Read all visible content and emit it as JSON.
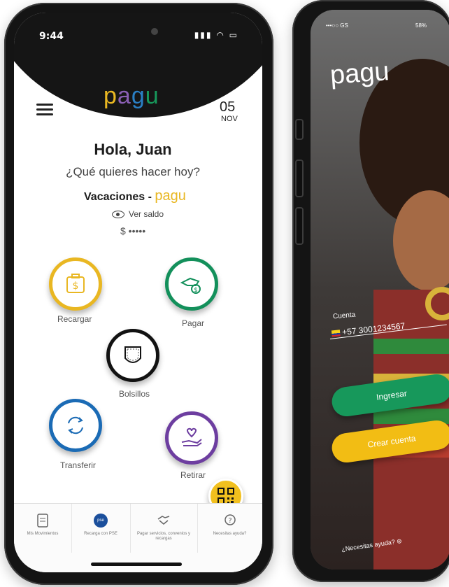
{
  "colors": {
    "recargar": "#e9b722",
    "pagar": "#13905b",
    "bolsillos": "#121212",
    "transferir": "#1b6bb5",
    "retirar": "#6d3ea0",
    "ingresar": "#17985b",
    "crear_cuenta": "#f2bd14"
  },
  "left_phone": {
    "status": {
      "time": "9:44"
    },
    "logo": {
      "l1": "p",
      "l2": "a",
      "l3": "g",
      "l4": "u"
    },
    "date": {
      "day": "05",
      "month": "NOV"
    },
    "greeting": "Hola, Juan",
    "question": "¿Qué quieres hacer hoy?",
    "wallet_name": "Vacaciones -",
    "wallet_brand": "pagu",
    "ver_saldo": "Ver saldo",
    "saldo": "$ •••••",
    "actions": {
      "recargar": {
        "label": "Recargar",
        "icon": "money-bag-icon"
      },
      "pagar": {
        "label": "Pagar",
        "icon": "hand-coin-icon"
      },
      "bolsillos": {
        "label": "Bolsillos",
        "icon": "pocket-icon"
      },
      "transferir": {
        "label": "Transferir",
        "icon": "transfer-arrows-icon"
      },
      "retirar": {
        "label": "Retirar",
        "icon": "hand-heart-icon"
      }
    },
    "bottom_nav": [
      {
        "label": "Mis Movimientos",
        "icon": "document-icon"
      },
      {
        "label": "Recarga con PSE",
        "icon": "pse-icon",
        "badge": "pse"
      },
      {
        "label": "Pagar servicios, convenios y recargas",
        "icon": "handshake-icon"
      },
      {
        "label": "Necesitas ayuda?",
        "icon": "help-icon"
      }
    ]
  },
  "right_phone": {
    "status_left": "•••○○ GS",
    "status_right": "58%",
    "logo": "pagu",
    "account_label": "Cuenta",
    "phone_value": "+57 3001234567",
    "ingresar_label": "Ingresar",
    "crear_cuenta_label": "Crear cuenta",
    "help_text": "¿Necesitas ayuda?"
  }
}
